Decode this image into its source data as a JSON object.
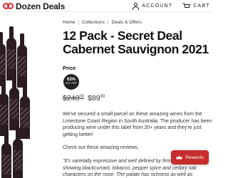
{
  "header": {
    "logo_text": "Dozen Deals",
    "account_label": "ACCOUNT",
    "cart_label": "CART",
    "brand_color": "#e3262c"
  },
  "breadcrumb": {
    "items": [
      "Home",
      "Collections",
      "Deals & Offers"
    ]
  },
  "product": {
    "title_lines": [
      "12 Pack - Secret Deal",
      "Cabernet Sauvignon 2021"
    ],
    "price_label": "Price",
    "badge_percent": "63%",
    "badge_text": "OFF RRP",
    "old_price_main": "$240",
    "old_price_cents": "00",
    "new_price_main": "$89",
    "new_price_cents": "00",
    "description": "We've secured a small parcel on these amazing wines from the Limestone Coast Region in South Australia. The producer has been producing wine under this label from 20+ years and they're just getting better!",
    "reviews_intro": "Check out these amazing reviews,",
    "quote": "\"It's varietally expressive and well defined by firm\nshowing blackcurrant, tobacco, pepper spice and cedary oak\ncharacters on the nose. The palate has richness as well as"
  },
  "rewards": {
    "label": "Rewards",
    "color": "#c72d2d"
  },
  "icons": [
    "account-icon",
    "cart-icon",
    "crown-icon"
  ]
}
